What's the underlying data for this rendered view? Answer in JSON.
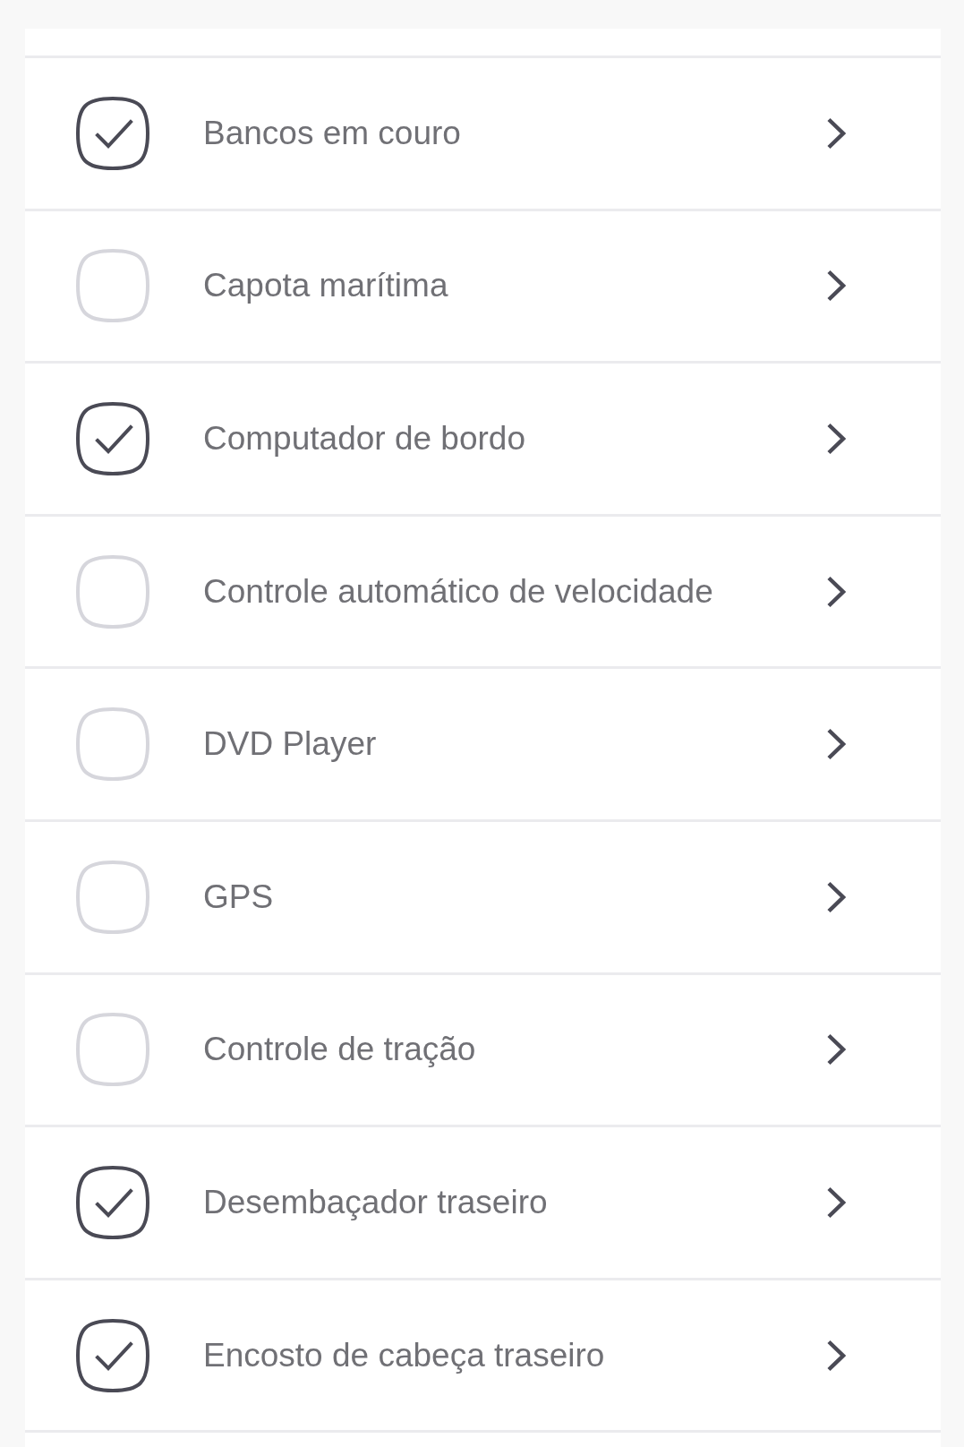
{
  "items": [
    {
      "label": "Bancos em couro",
      "checked": true
    },
    {
      "label": "Capota marítima",
      "checked": false
    },
    {
      "label": "Computador de bordo",
      "checked": true
    },
    {
      "label": "Controle automático de velocidade",
      "checked": false
    },
    {
      "label": "DVD Player",
      "checked": false
    },
    {
      "label": "GPS",
      "checked": false
    },
    {
      "label": "Controle de tração",
      "checked": false
    },
    {
      "label": "Desembaçador traseiro",
      "checked": true
    },
    {
      "label": "Encosto de cabeça traseiro",
      "checked": true
    }
  ]
}
